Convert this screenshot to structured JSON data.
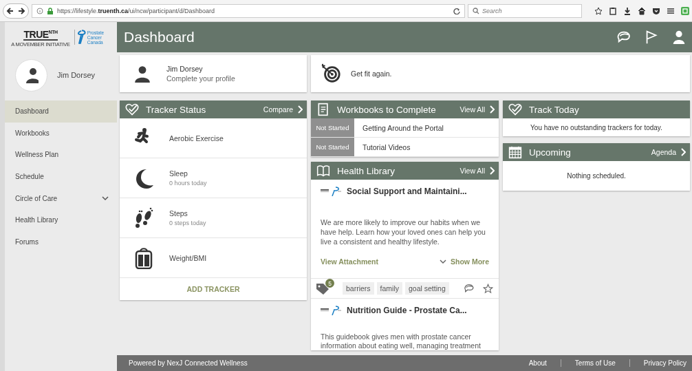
{
  "browser": {
    "url": "https://lifestyle.**truenth.ca**/ui/ncw/participant/d/Dashboard",
    "search": {
      "placeholder": "Search"
    }
  },
  "sidebar": {
    "logo": {
      "brand": "TRUE$^{NTH}$",
      "tagline": "A MOVEMBER INITIATIVE",
      "partner": "Prostate Cancer Canada"
    },
    "user": {
      "name": "Jim Dorsey"
    },
    "items": [
      {
        "label": "Dashboard",
        "selected": true,
        "expandable": false
      },
      {
        "label": "Workbooks",
        "selected": false,
        "expandable": false
      },
      {
        "label": "Wellness Plan",
        "selected": false,
        "expandable": false
      },
      {
        "label": "Schedule",
        "selected": false,
        "expandable": false
      },
      {
        "label": "Circle of Care",
        "selected": false,
        "expandable": true
      },
      {
        "label": "Health Library",
        "selected": false,
        "expandable": false
      },
      {
        "label": "Forums",
        "selected": false,
        "expandable": false
      }
    ]
  },
  "header": {
    "title": "Dashboard"
  },
  "profile_card": {
    "name": "Jim Dorsey",
    "hint": "Complete your profile"
  },
  "goal_card": {
    "text": "Get fit again."
  },
  "tracker_status": {
    "title": "Tracker Status",
    "action": "Compare",
    "rows": [
      {
        "kind": "aerobic",
        "label": "Aerobic Exercise"
      },
      {
        "kind": "sleep",
        "label": "Sleep",
        "detail": "0 hours today"
      },
      {
        "kind": "steps",
        "label": "Steps",
        "detail": "0 steps today"
      },
      {
        "kind": "weight",
        "label": "Weight/BMI"
      }
    ],
    "add": "ADD TRACKER"
  },
  "workbooks": {
    "title": "Workbooks to Complete",
    "action": "View All",
    "rows": [
      {
        "status": "Not Started",
        "title": "Getting Around the Portal"
      },
      {
        "status": "Not Started",
        "title": "Tutorial Videos"
      }
    ]
  },
  "health_library": {
    "title": "Health Library",
    "action": "View All",
    "articles": [
      {
        "title": "Social Support and Maintaini...",
        "body": "We are more likely to improve our habits when we have help. Learn how your loved ones can help you live a consistent and healthy lifestyle.",
        "attachment": "View Attachment",
        "more": "Show More",
        "count": "5",
        "tags": [
          "barriers",
          "family",
          "goal setting"
        ]
      },
      {
        "title": "Nutrition Guide - Prostate Ca...",
        "body": "This guidebook gives men with prostate cancer information about eating well, managing treatment"
      }
    ]
  },
  "track_today": {
    "title": "Track Today",
    "message": "You have no outstanding trackers for today."
  },
  "upcoming": {
    "title": "Upcoming",
    "action": "Agenda",
    "message": "Nothing scheduled."
  },
  "footer": {
    "powered": "Powered by NexJ Connected Wellness",
    "links": [
      "About",
      "Terms of Use",
      "Privacy Policy"
    ]
  }
}
